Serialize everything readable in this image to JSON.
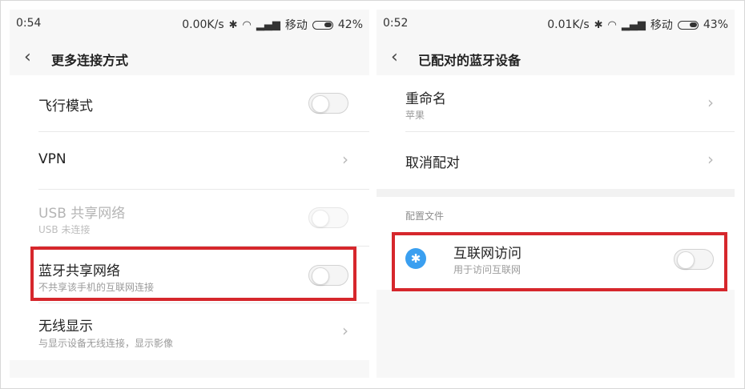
{
  "left": {
    "status": {
      "time": "0:54",
      "speed": "0.00K/s",
      "carrier": "移动",
      "battery": "42%",
      "icons": [
        "bluetooth-icon",
        "wifi-icon",
        "signal-icon",
        "battery-icon"
      ]
    },
    "header": {
      "back_icon": "‹",
      "title": "更多连接方式"
    },
    "items": [
      {
        "label": "飞行模式",
        "sub": ""
      },
      {
        "label": "VPN",
        "sub": ""
      },
      {
        "label": "USB 共享网络",
        "sub": "USB 未连接"
      },
      {
        "label": "蓝牙共享网络",
        "sub": "不共享该手机的互联网连接"
      },
      {
        "label": "无线显示",
        "sub": "与显示设备无线连接，显示影像"
      }
    ]
  },
  "right": {
    "status": {
      "time": "0:52",
      "speed": "0.01K/s",
      "carrier": "移动",
      "battery": "43%",
      "icons": [
        "bluetooth-icon",
        "wifi-icon",
        "signal-icon",
        "battery-icon"
      ]
    },
    "header": {
      "back_icon": "‹",
      "title": "已配对的蓝牙设备"
    },
    "items": [
      {
        "label": "重命名",
        "sub": "苹果"
      },
      {
        "label": "取消配对",
        "sub": ""
      }
    ],
    "section": {
      "title": "配置文件"
    },
    "profile": {
      "label": "互联网访问",
      "sub": "用于访问互联网",
      "icon": "bluetooth-icon"
    }
  },
  "colors": {
    "highlight": "#d6272c",
    "accent": "#3a9ff0"
  }
}
